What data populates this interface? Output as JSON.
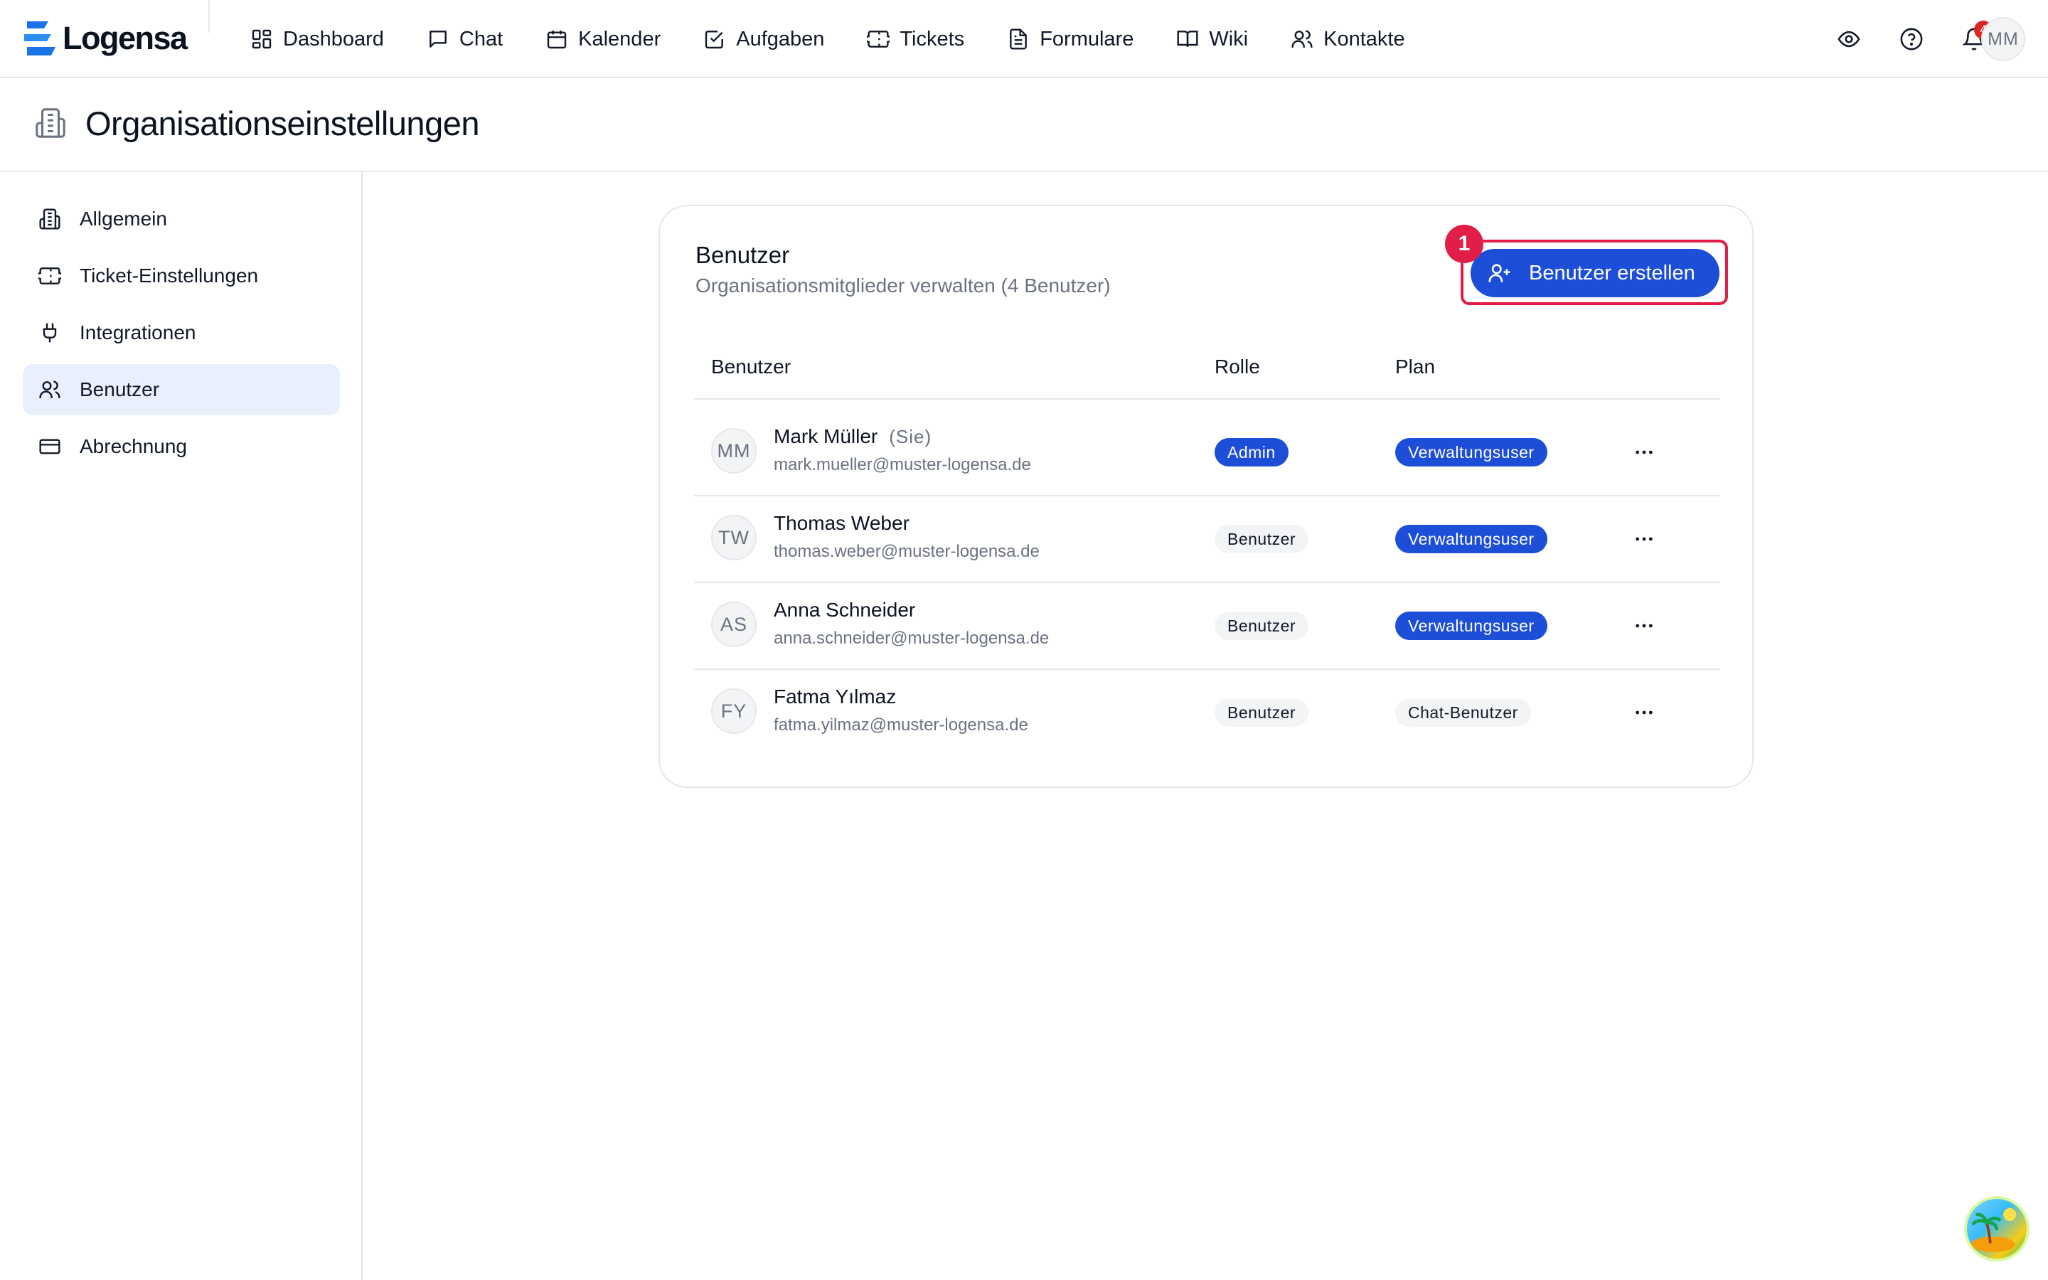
{
  "app": {
    "name": "Logensa",
    "user_initials": "MM"
  },
  "nav": {
    "items": [
      {
        "label": "Dashboard",
        "icon": "dashboard-icon"
      },
      {
        "label": "Chat",
        "icon": "chat-icon"
      },
      {
        "label": "Kalender",
        "icon": "calendar-icon"
      },
      {
        "label": "Aufgaben",
        "icon": "task-check-icon"
      },
      {
        "label": "Tickets",
        "icon": "ticket-icon"
      },
      {
        "label": "Formulare",
        "icon": "document-icon"
      },
      {
        "label": "Wiki",
        "icon": "book-icon"
      },
      {
        "label": "Kontakte",
        "icon": "users-icon"
      }
    ],
    "notification_count": "4"
  },
  "page": {
    "title": "Organisationseinstellungen"
  },
  "sidebar": {
    "items": [
      {
        "label": "Allgemein",
        "icon": "building-icon",
        "active": false
      },
      {
        "label": "Ticket-Einstellungen",
        "icon": "ticket-icon",
        "active": false
      },
      {
        "label": "Integrationen",
        "icon": "plug-icon",
        "active": false
      },
      {
        "label": "Benutzer",
        "icon": "users-icon",
        "active": true
      },
      {
        "label": "Abrechnung",
        "icon": "credit-card-icon",
        "active": false
      }
    ]
  },
  "card": {
    "title": "Benutzer",
    "subtitle": "Organisationsmitglieder verwalten (4 Benutzer)",
    "create_button": "Benutzer erstellen",
    "marker": "1",
    "columns": {
      "user": "Benutzer",
      "role": "Rolle",
      "plan": "Plan"
    },
    "users": [
      {
        "initials": "MM",
        "name": "Mark Müller",
        "you": "(Sie)",
        "email": "mark.mueller@muster-logensa.de",
        "role": "Admin",
        "plan": "Verwaltungsuser"
      },
      {
        "initials": "TW",
        "name": "Thomas Weber",
        "you": "",
        "email": "thomas.weber@muster-logensa.de",
        "role": "Benutzer",
        "plan": "Verwaltungsuser"
      },
      {
        "initials": "AS",
        "name": "Anna Schneider",
        "you": "",
        "email": "anna.schneider@muster-logensa.de",
        "role": "Benutzer",
        "plan": "Verwaltungsuser"
      },
      {
        "initials": "FY",
        "name": "Fatma Yılmaz",
        "you": "",
        "email": "fatma.yilmaz@muster-logensa.de",
        "role": "Benutzer",
        "plan": "Chat-Benutzer"
      }
    ]
  },
  "colors": {
    "accent": "#1d4ed8",
    "highlight": "#e11d48",
    "active_bg": "#e8f0fe",
    "badge_red": "#dc2626"
  }
}
